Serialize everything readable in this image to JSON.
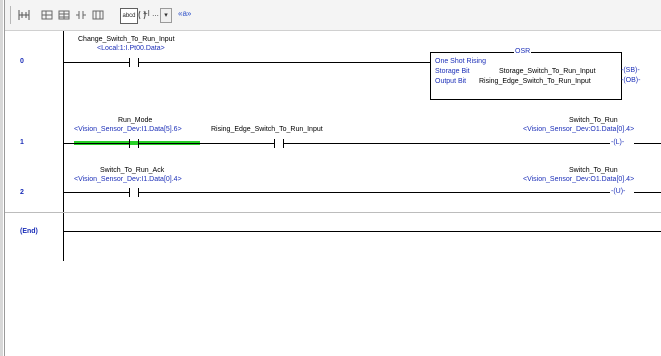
{
  "toolbar": {
    "items": [
      "rung-icon",
      "branch-icon",
      "branch-level-icon",
      "xic-icon",
      "xio-icon",
      "ote-icon"
    ],
    "boxed_label": "abcd",
    "dropdown_label": "+I ...",
    "arrows_label": "«a»"
  },
  "rungs": [
    {
      "number": "0",
      "contact_tag": "Change_Switch_To_Run_Input",
      "contact_addr": "<Local:1:I.Pt00.Data>",
      "instruction": {
        "title": "OSR",
        "rows": [
          {
            "label": "One Shot Rising",
            "value": ""
          },
          {
            "label": "Storage Bit",
            "value": "Storage_Switch_To_Run_Input"
          },
          {
            "label": "Output Bit",
            "value": "Rising_Edge_Switch_To_Run_Input"
          }
        ],
        "outputs": [
          "-(SB)-",
          "-(OB)-"
        ]
      }
    },
    {
      "number": "1",
      "contact1_tag": "Run_Mode",
      "contact1_addr": "<Vision_Sensor_Dev:I1.Data[5].6>",
      "contact2_tag": "Rising_Edge_Switch_To_Run_Input",
      "coil_tag": "Switch_To_Run",
      "coil_addr": "<Vision_Sensor_Dev:O1.Data[0].4>",
      "coil_symbol": "-(L)-"
    },
    {
      "number": "2",
      "contact_tag": "Switch_To_Run_Ack",
      "contact_addr": "<Vision_Sensor_Dev:I1.Data[0].4>",
      "coil_tag": "Switch_To_Run",
      "coil_addr": "<Vision_Sensor_Dev:O1.Data[0].4>",
      "coil_symbol": "-(U)-"
    }
  ],
  "end_label": "(End)",
  "colors": {
    "address_blue": "#1c2fb8",
    "highlight_green": "#28d028"
  }
}
